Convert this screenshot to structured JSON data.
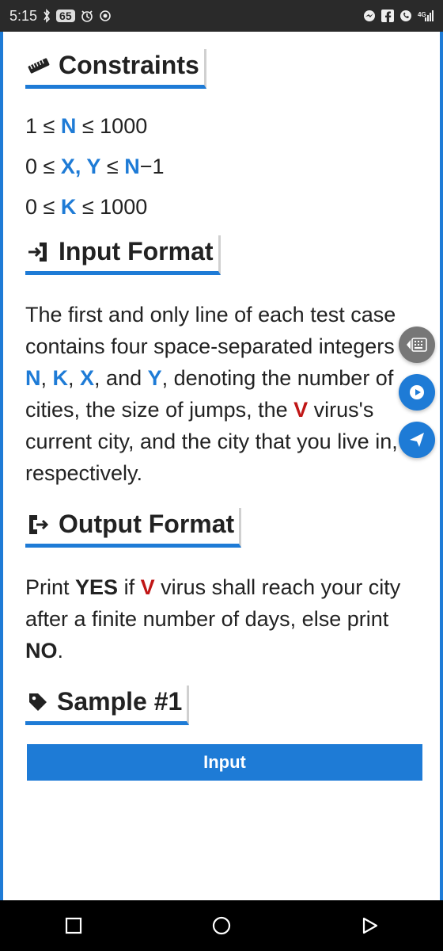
{
  "statusbar": {
    "time": "5:15",
    "badge": "65"
  },
  "sections": {
    "constraints": {
      "title": "Constraints",
      "lines": {
        "l1_a": "1 ≤ ",
        "l1_b": "N",
        "l1_c": " ≤ 1000",
        "l2_a": "0 ≤ ",
        "l2_b": "X, Y",
        "l2_c": " ≤ ",
        "l2_d": "N",
        "l2_e": "−1",
        "l3_a": "0 ≤ ",
        "l3_b": "K",
        "l3_c": " ≤ 1000"
      }
    },
    "input_format": {
      "title": "Input Format",
      "p": {
        "t1": "The first and only line of each test case contains four space-separated integers ",
        "n": "N",
        "c1": ", ",
        "k": "K",
        "c2": ", ",
        "x": "X",
        "c3": ", and ",
        "y": "Y",
        "t2": ", denoting the number of cities, the size of jumps, the ",
        "v": "V",
        "t3": " virus's current city, and the city that you live in, respectively."
      }
    },
    "output_format": {
      "title": "Output Format",
      "p": {
        "t1": "Print ",
        "yes": "YES",
        "t2": " if ",
        "v": "V",
        "t3": " virus shall reach your city after a finite number of days, else print ",
        "no": "NO",
        "t4": "."
      }
    },
    "sample": {
      "title": "Sample #1",
      "input_label": "Input"
    }
  }
}
